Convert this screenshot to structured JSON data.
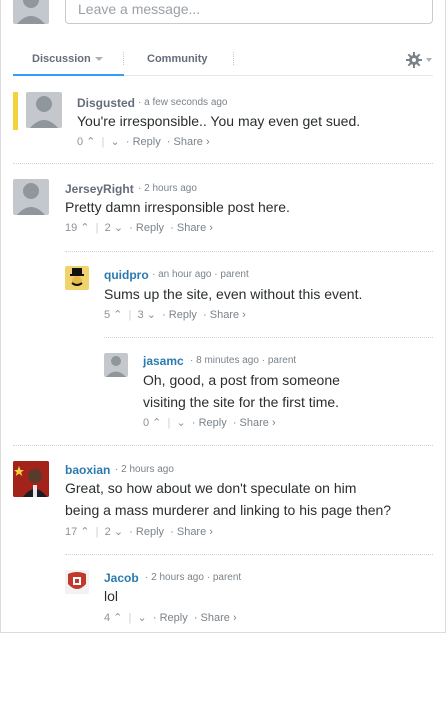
{
  "composer": {
    "placeholder": "Leave a message..."
  },
  "tabs": {
    "discussion": "Discussion",
    "community": "Community"
  },
  "comments": [
    {
      "author": "Disgusted",
      "time": "a few seconds ago",
      "parent": "",
      "body": "You're irresponsible.. You may even get sued.",
      "up": "0",
      "down": "",
      "reply": "Reply",
      "share": "Share ›"
    },
    {
      "author": "JerseyRight",
      "time": "2 hours ago",
      "parent": "",
      "body": "Pretty damn irresponsible post here.",
      "up": "19",
      "down": "2",
      "reply": "Reply",
      "share": "Share ›"
    },
    {
      "author": "quidpro",
      "time": "an hour ago",
      "parent": "parent",
      "body": "Sums up the site, even without this event.",
      "up": "5",
      "down": "3",
      "reply": "Reply",
      "share": "Share ›"
    },
    {
      "author": "jasamc",
      "time": "8 minutes ago",
      "parent": "parent",
      "body_line1": "Oh, good, a post from someone",
      "body_line2": "visiting the site for the first time.",
      "up": "0",
      "down": "",
      "reply": "Reply",
      "share": "Share ›"
    },
    {
      "author": "baoxian",
      "time": "2 hours ago",
      "parent": "",
      "body_line1": "Great, so how about we don't speculate on him",
      "body_line2": "being a mass murderer and linking to his page then?",
      "up": "17",
      "down": "2",
      "reply": "Reply",
      "share": "Share ›"
    },
    {
      "author": "Jacob",
      "time": "2 hours ago",
      "parent": "parent",
      "body": "lol",
      "up": "4",
      "down": "",
      "reply": "Reply",
      "share": "Share ›"
    }
  ],
  "colors": {
    "accent": "#2e9fff",
    "author_gray": "#656c7a",
    "author_blue": "#2a7ab0",
    "new_bar": "#f5d13a"
  }
}
